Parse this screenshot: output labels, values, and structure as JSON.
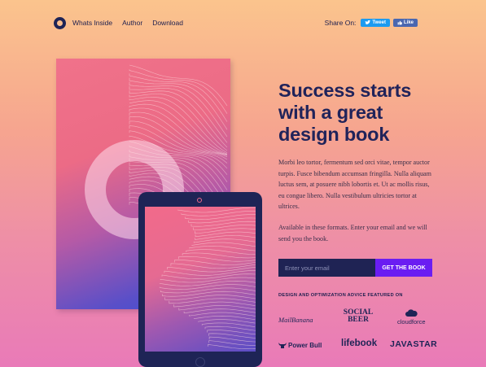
{
  "nav": {
    "links": [
      "Whats Inside",
      "Author",
      "Download"
    ],
    "share_label": "Share On:",
    "tweet_label": "Tweet",
    "like_label": "Like"
  },
  "hero": {
    "headline": "Success starts with a great design book",
    "description": "Morbi leo tortor, fermentum sed orci vitae, tempor auctor turpis. Fusce bibendum accumsan fringilla. Nulla aliquam luctus sem, at posuere nibh lobortis et. Ut ac mollis risus, eu congue libero. Nulla vestibulum ultricies tortor at ultrices.",
    "formats_text": "Available in these formats. Enter your email and we will send you the book."
  },
  "signup": {
    "email_placeholder": "Enter your email",
    "button_label": "GET THE BOOK"
  },
  "featured": {
    "heading": "DESIGN AND OPTIMIZATION ADVICE FEATURED ON",
    "brands": [
      "MailBanana",
      "SOCIAL BEER",
      "cloudforce",
      "Power Bull",
      "lifebook",
      "JAVASTAR"
    ]
  },
  "colors": {
    "navy": "#1e2456",
    "purple_button": "#6a1df2",
    "tweet_blue": "#1d9bf0",
    "facebook_blue": "#4a67b0"
  }
}
